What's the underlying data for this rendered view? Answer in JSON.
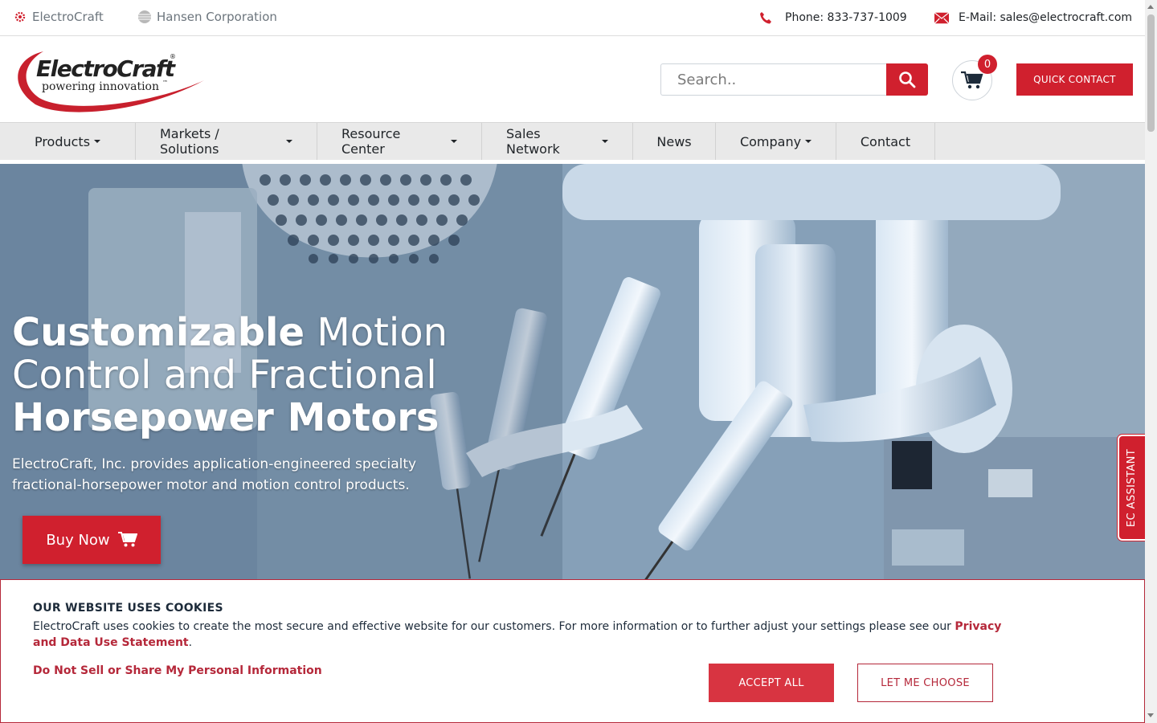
{
  "topbar": {
    "brand1": "ElectroCraft",
    "brand2": "Hansen Corporation",
    "phone": "Phone: 833-737-1009",
    "email": "E-Mail: sales@electrocraft.com"
  },
  "header": {
    "logo_main": "ElectroCraft",
    "logo_reg": "®",
    "logo_tagline": "powering innovation",
    "logo_tm": "™",
    "search_placeholder": "Search..",
    "cart_count": "0",
    "quick_contact": "QUICK CONTACT"
  },
  "nav": {
    "items": [
      {
        "label": "Products",
        "dropdown": true
      },
      {
        "label": "Markets / Solutions",
        "dropdown": true
      },
      {
        "label": "Resource Center",
        "dropdown": true
      },
      {
        "label": "Sales Network",
        "dropdown": true
      },
      {
        "label": "News",
        "dropdown": false
      },
      {
        "label": "Company",
        "dropdown": true
      },
      {
        "label": "Contact",
        "dropdown": false
      }
    ]
  },
  "hero": {
    "title_bold1": "Customizable",
    "title_reg1": " Motion",
    "title_reg2": "Control and Fractional",
    "title_bold2": "Horsepower Motors",
    "subtitle": "ElectroCraft, Inc. provides application-engineered specialty fractional-horsepower motor and motion control products.",
    "buy_now": "Buy Now"
  },
  "assistant": {
    "label": "EC ASSISTANT"
  },
  "cookie": {
    "title": "OUR WEBSITE USES COOKIES",
    "text": "ElectroCraft uses cookies to create the most secure and effective website for our customers. For more information or to further adjust your settings please see our ",
    "policy_link": "Privacy and Data Use Statement",
    "period": ".",
    "do_not_sell": "Do Not Sell or Share My Personal Information",
    "accept": "ACCEPT ALL",
    "choose": "LET ME CHOOSE"
  },
  "colors": {
    "brand_red": "#d0202e",
    "nav_bg": "#e9e9e9",
    "cookie_text": "#1d2b3a"
  }
}
